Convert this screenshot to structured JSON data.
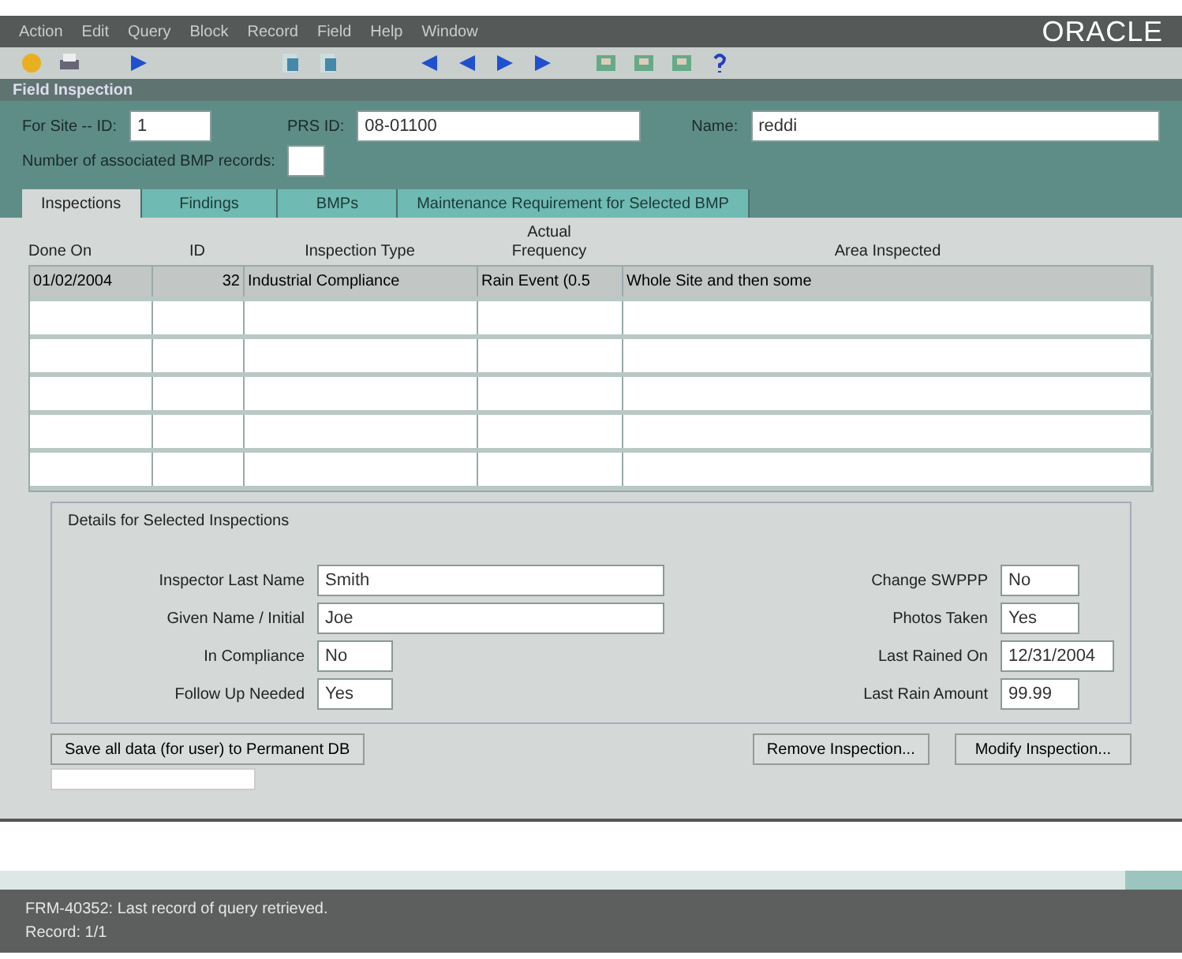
{
  "menu": [
    "Action",
    "Edit",
    "Query",
    "Block",
    "Record",
    "Field",
    "Help",
    "Window"
  ],
  "brand": "ORACLE",
  "window": {
    "title": "Field Inspection"
  },
  "header": {
    "site_label": "For Site -- ID:",
    "site_id": "1",
    "prs_label": "PRS ID:",
    "prs_id": "08-01100",
    "name_label": "Name:",
    "name": "reddi",
    "bmp_label": "Number of associated BMP records:"
  },
  "tabs": [
    {
      "label": "Inspections",
      "selected": true
    },
    {
      "label": "Findings",
      "selected": false
    },
    {
      "label": "BMPs",
      "selected": false
    },
    {
      "label": "Maintenance Requirement for Selected BMP",
      "selected": false
    }
  ],
  "table": {
    "columns": [
      "Done On",
      "ID",
      "Inspection Type",
      "Actual\nFrequency",
      "Area Inspected"
    ],
    "rows": [
      {
        "cells": [
          "01/02/2004",
          "32",
          "Industrial Compliance",
          "Rain Event (0.5",
          "Whole Site and then some"
        ],
        "selected": true
      }
    ]
  },
  "details": {
    "title": "Details for Selected Inspections",
    "left": [
      {
        "label": "Inspector Last Name",
        "value": "Smith"
      },
      {
        "label": "Given Name / Initial",
        "value": "Joe"
      },
      {
        "label": "In Compliance",
        "value": "No"
      },
      {
        "label": "Follow Up Needed",
        "value": "Yes"
      }
    ],
    "right": [
      {
        "label": "Change SWPPP",
        "value": "No"
      },
      {
        "label": "Photos Taken",
        "value": "Yes"
      },
      {
        "label": "Last Rained On",
        "value": "12/31/2004"
      },
      {
        "label": "Last Rain Amount",
        "value": "99.99"
      }
    ]
  },
  "buttons": [
    "Save all data (for user) to Permanent DB",
    "Remove Inspection...",
    "Modify Inspection..."
  ],
  "status_bar": {
    "message": "FRM-40352: Last record of query retrieved.",
    "record": "Record: 1/1"
  }
}
